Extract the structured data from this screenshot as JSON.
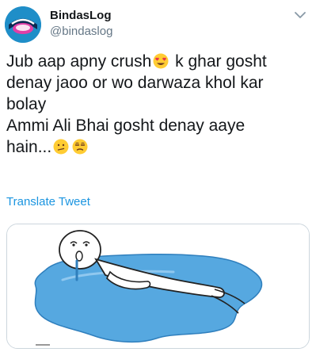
{
  "tweet": {
    "display_name": "BindasLog",
    "handle": "@bindaslog",
    "text_lines": [
      {
        "before": "Jub aap apny crush",
        "after": " k ghar gosht"
      },
      {
        "text": "denay jaoo or wo darwaza khol kar"
      },
      {
        "text": "bolay"
      },
      {
        "text": "Ammi Ali Bhai gosht denay aaye"
      },
      {
        "text": "hain..."
      }
    ],
    "emojis": [
      "heart-eyes-emoji",
      "confused-emoji",
      "unamused-emoji"
    ],
    "translate_label": "Translate Tweet"
  },
  "colors": {
    "link": "#1b95e0",
    "handle": "#657786",
    "text": "#14171a",
    "avatar_bg": "#1f8ec8",
    "puddle": "#56a8e0"
  },
  "icons": {
    "menu": "chevron-down-icon"
  }
}
